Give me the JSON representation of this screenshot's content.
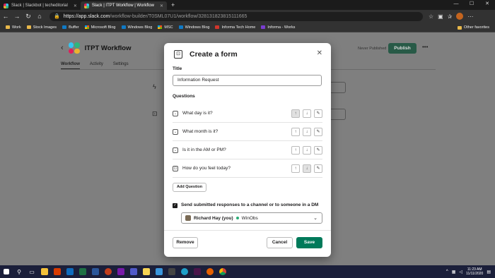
{
  "browser": {
    "tabs": [
      {
        "label": "Slack | Slackbot | techeditorial",
        "active": false
      },
      {
        "label": "Slack | ITPT Workflow | Workflow",
        "active": true
      }
    ],
    "url_host": "https://app.slack.com",
    "url_path": "/workflow-builder/T0SML07U1/workflow/328131823815111665",
    "bookmarks": [
      "Work",
      "Stock Images",
      "Buffer",
      "Microsoft Blog",
      "Windows Blog",
      "MSC",
      "Windows Blog",
      "Informa Tech Home",
      "Informa - Works"
    ],
    "bookmarks_right": "Other favorites"
  },
  "slack": {
    "workflow_title": "ITPT Workflow",
    "unpublished": "Never Published",
    "publish_label": "Publish",
    "tabs": [
      "Workflow",
      "Activity",
      "Settings"
    ]
  },
  "modal": {
    "title": "Create a form",
    "title_label": "Title",
    "title_value": "Information Request",
    "questions_label": "Questions",
    "questions": [
      {
        "text": "What day is it?",
        "icon": "dropdown-icon"
      },
      {
        "text": "What month is it?",
        "icon": "dropdown-icon"
      },
      {
        "text": "Is it in the AM or PM?",
        "icon": "dropdown-icon"
      },
      {
        "text": "How do you feel today?",
        "icon": "text-input-icon"
      }
    ],
    "add_question": "Add Question",
    "send_label": "Send submitted responses to a channel or to someone in a DM",
    "recipient": "Richard Hay (you)",
    "recipient_extra": "WinObs",
    "remove_label": "Remove",
    "cancel_label": "Cancel",
    "save_label": "Save"
  },
  "taskbar": {
    "time": "11:23 AM",
    "date": "11/11/2020"
  },
  "colors": {
    "save": "#007a5a",
    "publish": "#285a47",
    "taskbar": "#1b1f3a"
  }
}
